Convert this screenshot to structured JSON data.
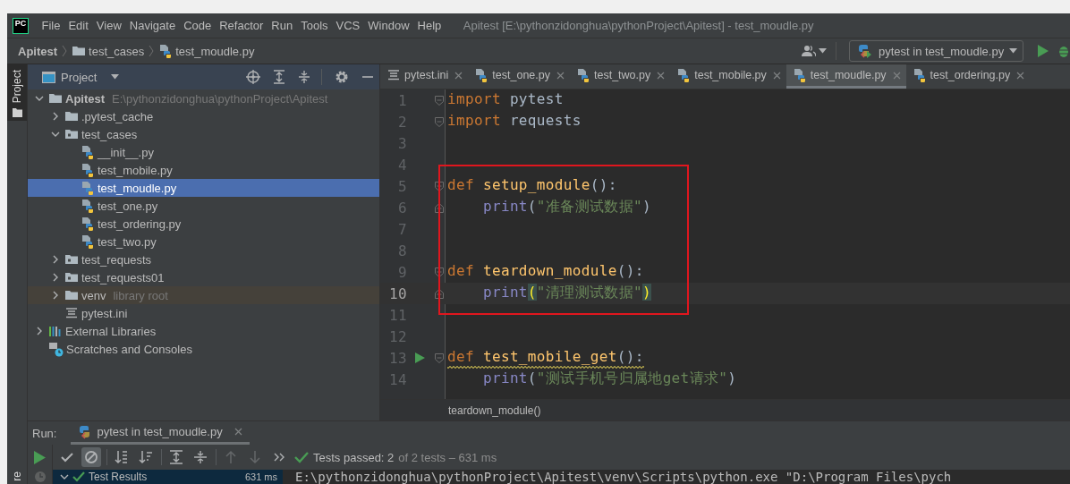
{
  "app_logo": "PC",
  "menu": [
    "File",
    "Edit",
    "View",
    "Navigate",
    "Code",
    "Refactor",
    "Run",
    "Tools",
    "VCS",
    "Window",
    "Help"
  ],
  "window": {
    "title": "Apitest [E:\\pythonzidonghua\\pythonProject\\Apitest] - test_moudle.py"
  },
  "breadcrumbs": [
    {
      "label": "Apitest",
      "kind": "project"
    },
    {
      "label": "test_cases",
      "kind": "folder"
    },
    {
      "label": "test_moudle.py",
      "kind": "python"
    }
  ],
  "run_config": {
    "label": "pytest in test_moudle.py"
  },
  "side_tabs": [
    {
      "label": "Project",
      "selected": true
    },
    {
      "label": "re",
      "selected": false
    }
  ],
  "project": {
    "title": "Project",
    "tree": [
      {
        "label": "Apitest",
        "hint": "E:\\pythonzidonghua\\pythonProject\\Apitest",
        "kind": "module",
        "expanded": true,
        "selected": false,
        "children": [
          {
            "label": ".pytest_cache",
            "kind": "folder",
            "expanded": false,
            "selected": false
          },
          {
            "label": "test_cases",
            "kind": "package",
            "expanded": true,
            "selected": false,
            "children": [
              {
                "label": "__init__.py",
                "kind": "python",
                "selected": false
              },
              {
                "label": "test_mobile.py",
                "kind": "python",
                "selected": false
              },
              {
                "label": "test_moudle.py",
                "kind": "python",
                "selected": true
              },
              {
                "label": "test_one.py",
                "kind": "python",
                "selected": false
              },
              {
                "label": "test_ordering.py",
                "kind": "python",
                "selected": false
              },
              {
                "label": "test_two.py",
                "kind": "python",
                "selected": false
              }
            ]
          },
          {
            "label": "test_requests",
            "kind": "package",
            "expanded": false,
            "selected": false
          },
          {
            "label": "test_requests01",
            "kind": "package",
            "expanded": false,
            "selected": false
          },
          {
            "label": "venv",
            "hint": "library root",
            "kind": "library-folder",
            "expanded": false,
            "selected": false
          },
          {
            "label": "pytest.ini",
            "kind": "ini",
            "selected": false
          }
        ]
      },
      {
        "label": "External Libraries",
        "kind": "libraries",
        "expanded": false,
        "selected": false
      },
      {
        "label": "Scratches and Consoles",
        "kind": "scratches",
        "selected": false
      }
    ]
  },
  "editor_tabs": [
    {
      "label": "pytest.ini",
      "kind": "ini",
      "selected": false
    },
    {
      "label": "test_one.py",
      "kind": "python",
      "selected": false
    },
    {
      "label": "test_two.py",
      "kind": "python",
      "selected": false
    },
    {
      "label": "test_mobile.py",
      "kind": "python",
      "selected": false
    },
    {
      "label": "test_moudle.py",
      "kind": "python",
      "selected": true
    },
    {
      "label": "test_ordering.py",
      "kind": "python",
      "selected": false
    }
  ],
  "code": {
    "blocks": [
      {
        "boxed": false,
        "lines": [
          {
            "number": "1",
            "current": false,
            "run_marker": false,
            "warning": false,
            "tokens": [
              {
                "kind": "keyword",
                "text": "import"
              },
              {
                "kind": "plain",
                "text": " pytest"
              }
            ]
          },
          {
            "number": "2",
            "current": false,
            "run_marker": false,
            "warning": false,
            "tokens": [
              {
                "kind": "keyword",
                "text": "import"
              },
              {
                "kind": "plain",
                "text": " requests"
              }
            ]
          },
          {
            "number": "3",
            "current": false,
            "run_marker": false,
            "warning": false
          },
          {
            "number": "4",
            "current": false,
            "run_marker": false,
            "warning": false
          }
        ]
      },
      {
        "boxed": true,
        "lines": [
          {
            "number": "5",
            "current": false,
            "run_marker": false,
            "warning": false,
            "tokens": [
              {
                "kind": "keyword",
                "text": "def "
              },
              {
                "kind": "function",
                "text": "setup_module"
              },
              {
                "kind": "plain",
                "text": "():"
              }
            ]
          },
          {
            "number": "6",
            "current": false,
            "run_marker": false,
            "warning": false,
            "tokens": [
              {
                "kind": "builtin",
                "text": "    print"
              },
              {
                "kind": "plain",
                "text": "("
              },
              {
                "kind": "string",
                "text": "\"准备测试数据\""
              },
              {
                "kind": "plain",
                "text": ")"
              }
            ]
          },
          {
            "number": "7",
            "current": false,
            "run_marker": false,
            "warning": false
          },
          {
            "number": "8",
            "current": false,
            "run_marker": false,
            "warning": false
          },
          {
            "number": "9",
            "current": false,
            "run_marker": false,
            "warning": false,
            "tokens": [
              {
                "kind": "keyword",
                "text": "def "
              },
              {
                "kind": "function",
                "text": "teardown_module"
              },
              {
                "kind": "plain",
                "text": "():"
              }
            ]
          },
          {
            "number": "10",
            "current": true,
            "run_marker": false,
            "warning": false,
            "tokens": [
              {
                "kind": "builtin",
                "text": "    print"
              },
              {
                "kind": "brace-match",
                "text": "("
              },
              {
                "kind": "string",
                "text": "\"清理测试数据\""
              },
              {
                "kind": "brace-match",
                "text": ")"
              }
            ]
          }
        ]
      },
      {
        "boxed": false,
        "lines": [
          {
            "number": "11",
            "current": false,
            "run_marker": false,
            "warning": false
          },
          {
            "number": "12",
            "current": false,
            "run_marker": false,
            "warning": false
          },
          {
            "number": "13",
            "current": false,
            "run_marker": true,
            "warning": true,
            "tokens": [
              {
                "kind": "keyword",
                "text": "def "
              },
              {
                "kind": "function",
                "text": "test_mobile_get"
              },
              {
                "kind": "plain",
                "text": "():"
              }
            ]
          },
          {
            "number": "14",
            "current": false,
            "run_marker": false,
            "warning": false,
            "tokens": [
              {
                "kind": "builtin",
                "text": "    print"
              },
              {
                "kind": "plain",
                "text": "("
              },
              {
                "kind": "string",
                "text": "\"测试手机号归属地get请求\""
              },
              {
                "kind": "plain",
                "text": ")"
              }
            ]
          }
        ]
      }
    ]
  },
  "editor_breadcrumb": "teardown_module()",
  "run_panel": {
    "label": "Run:",
    "tab": {
      "label": "pytest in test_moudle.py",
      "selected": true
    },
    "side_toolbar": [
      {
        "kind": "rerun"
      }
    ],
    "toolbar": [
      {
        "kind": "show-passed",
        "on": false,
        "disabled": false
      },
      {
        "kind": "show-ignored",
        "on": true,
        "disabled": false
      },
      {
        "kind": "sort-alpha",
        "on": false,
        "disabled": false
      },
      {
        "kind": "sort-duration",
        "on": false,
        "disabled": false
      },
      {
        "kind": "expand-all",
        "on": false,
        "disabled": false
      },
      {
        "kind": "collapse-all",
        "on": false,
        "disabled": false
      },
      {
        "kind": "previous",
        "on": false,
        "disabled": true
      },
      {
        "kind": "next",
        "on": false,
        "disabled": true
      },
      {
        "kind": "more",
        "on": false,
        "disabled": false
      }
    ],
    "status": {
      "passed": true,
      "summary": "Tests passed: 2",
      "detail": "of 2 tests – 631 ms"
    },
    "results": [
      {
        "label": "Test Results",
        "time": "631 ms",
        "passed": true,
        "expanded": true,
        "selected": true
      }
    ],
    "console": [
      "E:\\pythonzidonghua\\pythonProject\\Apitest\\venv\\Scripts\\python.exe \"D:\\Program Files\\pych"
    ]
  }
}
